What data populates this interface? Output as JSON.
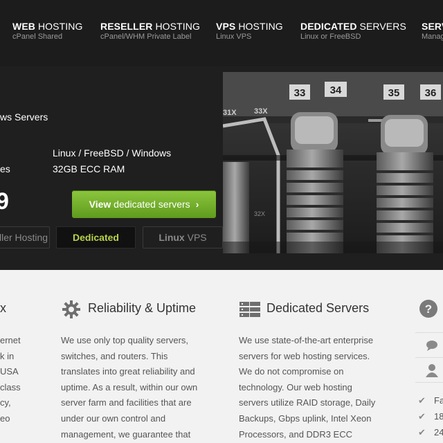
{
  "nav": {
    "items": [
      {
        "title_bold": "WEB",
        "title_rest": " HOSTING",
        "sub": "cPanel Shared"
      },
      {
        "title_bold": "RESELLER",
        "title_rest": " HOSTING",
        "sub": "cPanel/WHM Private Label"
      },
      {
        "title_bold": "VPS",
        "title_rest": " HOSTING",
        "sub": "Linux VPS"
      },
      {
        "title_bold": "DEDICATED",
        "title_rest": " SERVERS",
        "sub": "Linux or FreeBSD"
      },
      {
        "title_bold": "SERV",
        "title_rest": "",
        "sub": "Manag"
      }
    ]
  },
  "hero": {
    "heading_fragment": "ws Servers",
    "row1_label": "",
    "row1_value": "Linux / FreeBSD / Windows",
    "row2_label": "es",
    "row2_value": "32GB ECC RAM",
    "price_fragment": "9",
    "cta_bold": "View",
    "cta_rest": " dedicated servers",
    "cta_chevron": "›",
    "tabs": [
      {
        "label": "ller Hosting"
      },
      {
        "label": "Dedicated"
      },
      {
        "label_bold": "Linux",
        "label_rest": " VPS"
      }
    ],
    "port_labels": [
      "33",
      "34",
      "35",
      "36"
    ],
    "port_codes": [
      "31X",
      "33X",
      "32X"
    ]
  },
  "features": {
    "col0_title_fragment": "x",
    "col0_lines": [
      "ernet",
      "k in",
      "USA",
      "class",
      "",
      "cy,",
      "eo"
    ],
    "col1_title": "Reliability & Uptime",
    "col1_lines": [
      "We use only top quality servers,",
      "switches, and routers. This",
      "translates into great reliability and",
      "uptime. As a result, within our own",
      "server farm and facilities that are",
      "under our own control and",
      "management, we guarantee that"
    ],
    "col2_title": "Dedicated Servers",
    "col2_lines": [
      "We use state-of-the-art enterprise",
      "servers for web hosting services.",
      "We do not compromise on",
      "technology. Our web hosting",
      "servers utilize RAID storage, Daily",
      "Backups, Gbps uplink, Intel Xeon",
      "Processors, and DDR3 ECC"
    ],
    "col3_checks": [
      "Fa",
      "18",
      "24"
    ]
  },
  "icons": {
    "gear": "gear-icon",
    "server": "server-stack-icon",
    "help": "question-circle-icon",
    "chat": "chat-bubble-icon",
    "user": "user-icon",
    "check": "check-icon"
  },
  "colors": {
    "accent_green": "#7ab52f",
    "tab_active_text": "#b7d44a",
    "nav_bg": "#1c1c1c"
  }
}
